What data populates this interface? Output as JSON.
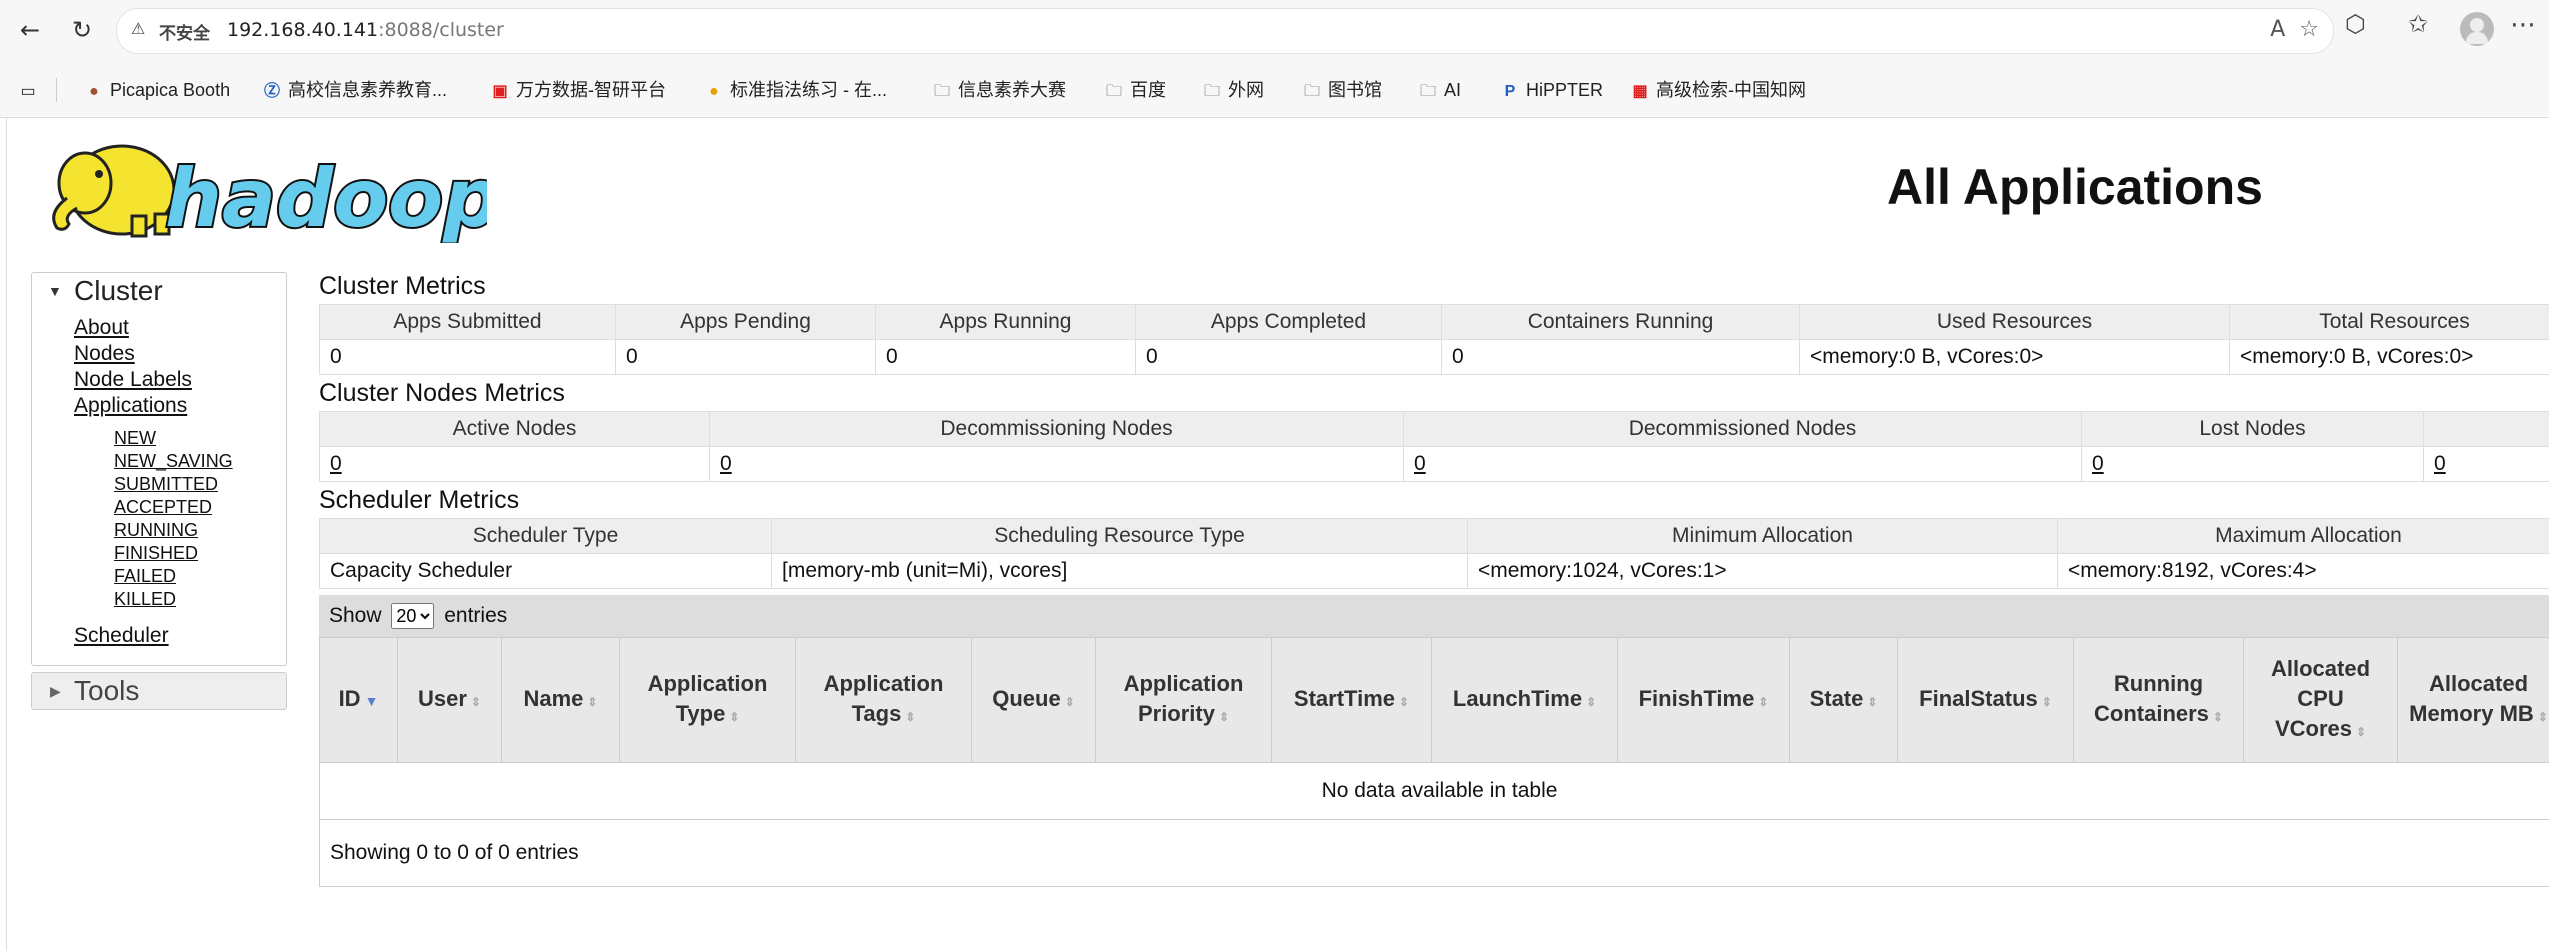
{
  "browser": {
    "warning_icon": "warning-triangle-icon",
    "insecure_label": "不安全",
    "url_host": "192.168.40.141",
    "url_rest": ":8088/cluster",
    "bookmarks": [
      {
        "label": "Picapica Booth",
        "icon": "🟤"
      },
      {
        "label": "高校信息素养教育...",
        "icon": "Ⓩ"
      },
      {
        "label": "万方数据-智研平台",
        "icon": "▣"
      },
      {
        "label": "标准指法练习 - 在...",
        "icon": "●"
      },
      {
        "label": "信息素养大赛",
        "icon": "folder-icon"
      },
      {
        "label": "百度",
        "icon": "folder-icon"
      },
      {
        "label": "外网",
        "icon": "folder-icon"
      },
      {
        "label": "图书馆",
        "icon": "folder-icon"
      },
      {
        "label": "AI",
        "icon": "folder-icon"
      },
      {
        "label": "HiPPTER",
        "icon": "P"
      },
      {
        "label": "高级检索-中国知网",
        "icon": "▦"
      }
    ]
  },
  "page": {
    "logo_text": "hadoop",
    "title": "All Applications"
  },
  "sidebar": {
    "cluster": {
      "title": "Cluster",
      "links": [
        "About",
        "Nodes",
        "Node Labels",
        "Applications"
      ],
      "states": [
        "NEW",
        "NEW_SAVING",
        "SUBMITTED",
        "ACCEPTED",
        "RUNNING",
        "FINISHED",
        "FAILED",
        "KILLED"
      ],
      "scheduler": "Scheduler"
    },
    "tools": {
      "title": "Tools"
    }
  },
  "cluster_metrics": {
    "title": "Cluster Metrics",
    "headers": [
      "Apps Submitted",
      "Apps Pending",
      "Apps Running",
      "Apps Completed",
      "Containers Running",
      "Used Resources",
      "Total Resources"
    ],
    "values": [
      "0",
      "0",
      "0",
      "0",
      "0",
      "<memory:0 B, vCores:0>",
      "<memory:0 B, vCores:0>"
    ]
  },
  "node_metrics": {
    "title": "Cluster Nodes Metrics",
    "headers": [
      "Active Nodes",
      "Decommissioning Nodes",
      "Decommissioned Nodes",
      "Lost Nodes",
      ""
    ],
    "values": [
      "0",
      "0",
      "0",
      "0",
      "0"
    ]
  },
  "scheduler_metrics": {
    "title": "Scheduler Metrics",
    "headers": [
      "Scheduler Type",
      "Scheduling Resource Type",
      "Minimum Allocation",
      "Maximum Allocation"
    ],
    "values": [
      "Capacity Scheduler",
      "[memory-mb (unit=Mi), vcores]",
      "<memory:1024, vCores:1>",
      "<memory:8192, vCores:4>"
    ]
  },
  "apps_table": {
    "show_label": "Show",
    "page_size": "20",
    "entries_label": "entries",
    "columns": [
      "ID",
      "User",
      "Name",
      "Application Type",
      "Application Tags",
      "Queue",
      "Application Priority",
      "StartTime",
      "LaunchTime",
      "FinishTime",
      "State",
      "FinalStatus",
      "Running Containers",
      "Allocated CPU VCores",
      "Allocated Memory MB"
    ],
    "empty_message": "No data available in table",
    "info": "Showing 0 to 0 of 0 entries"
  }
}
